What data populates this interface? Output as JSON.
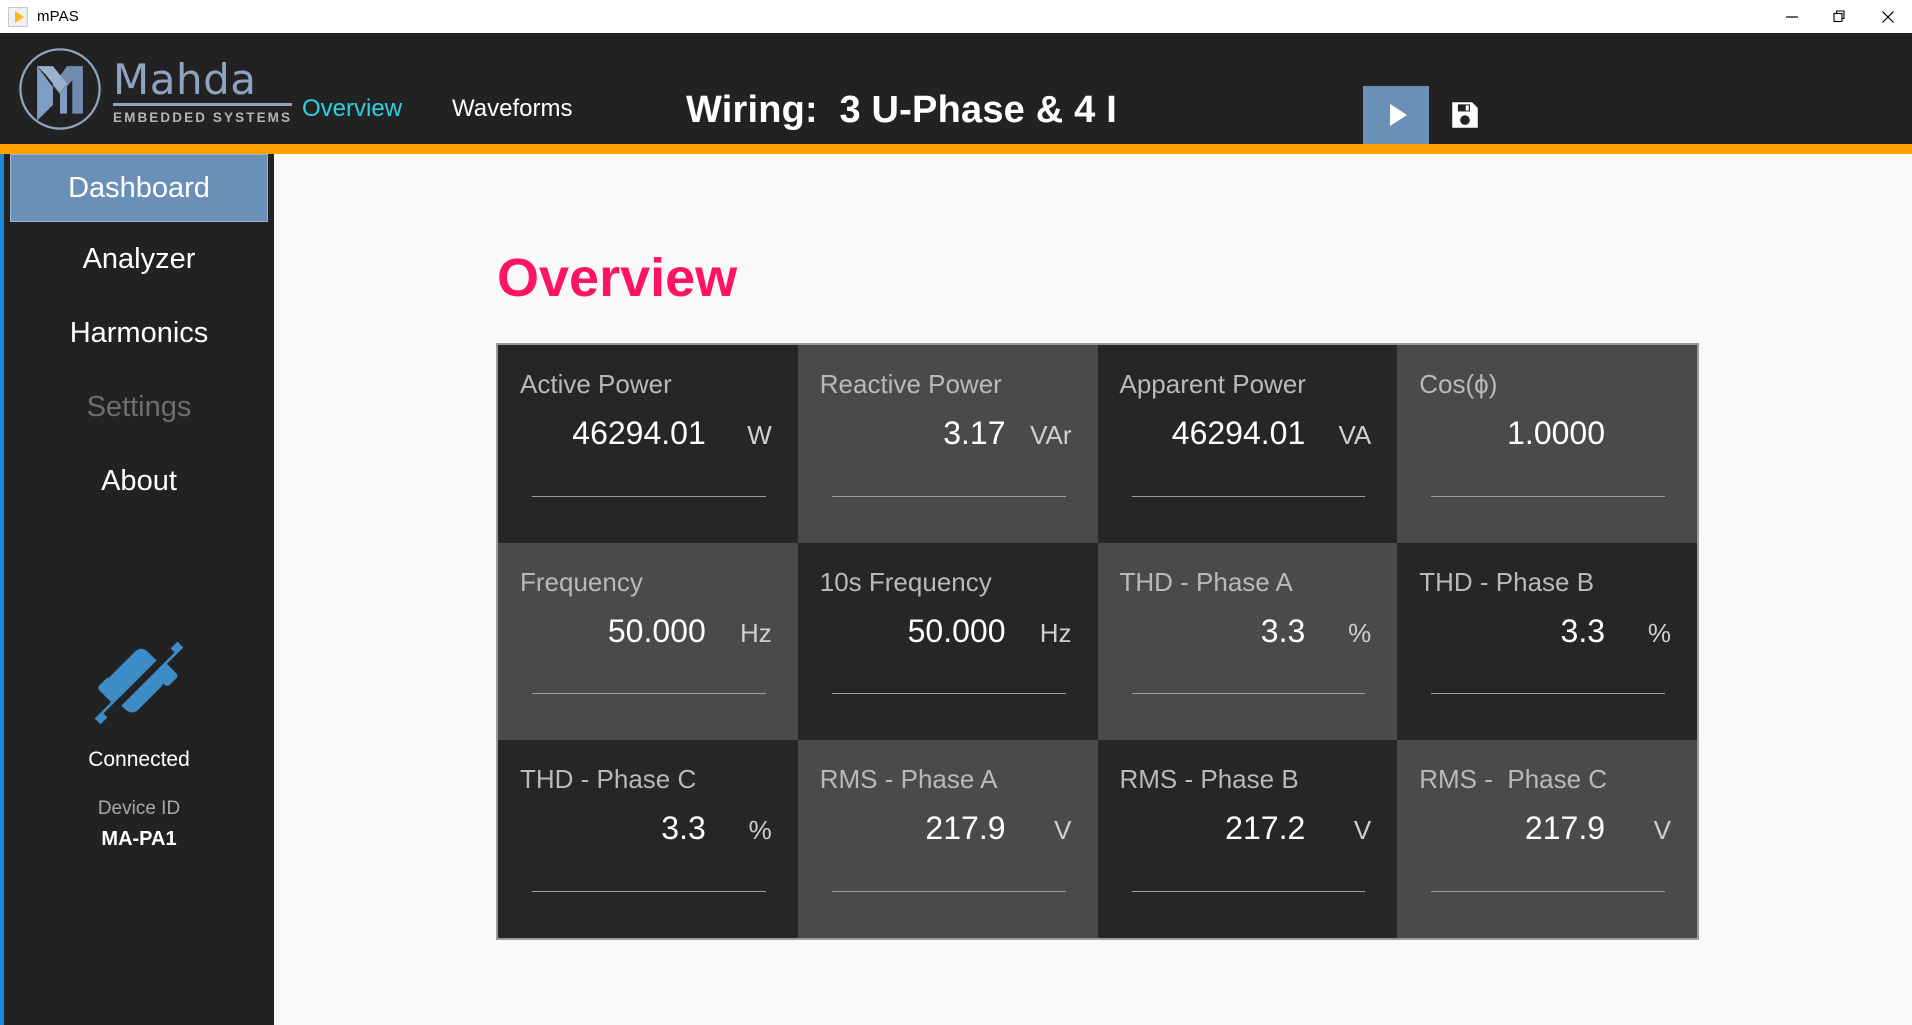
{
  "window": {
    "title": "mPAS",
    "app_icon": "play-app-icon",
    "controls": [
      {
        "name": "minimize",
        "glyph": "minimize-icon"
      },
      {
        "name": "restore",
        "glyph": "restore-icon"
      },
      {
        "name": "close",
        "glyph": "close-icon"
      }
    ]
  },
  "header": {
    "logo": {
      "word": "Mahda",
      "subtitle": "EMBEDDED SYSTEMS",
      "mark": "m-monogram-logo"
    },
    "nav": [
      {
        "label": "Overview",
        "active": true
      },
      {
        "label": "Waveforms",
        "active": false
      }
    ],
    "wiring_label": "Wiring:",
    "wiring_value": "3 U-Phase & 4 I",
    "play_button": "play-icon",
    "save_button": "floppy-save-icon",
    "accent_orange": "#FFA000",
    "nav_active_color": "#2AD2E6"
  },
  "sidebar": {
    "items": [
      {
        "label": "Dashboard",
        "state": "active"
      },
      {
        "label": "Analyzer",
        "state": "normal"
      },
      {
        "label": "Harmonics",
        "state": "normal"
      },
      {
        "label": "Settings",
        "state": "disabled"
      },
      {
        "label": "About",
        "state": "normal"
      }
    ],
    "connection": {
      "icon": "plug-connected-icon",
      "status": "Connected",
      "device_id_label": "Device ID",
      "device_id_value": "MA-PA1",
      "icon_color": "#3E8CC7"
    }
  },
  "main": {
    "title": "Overview",
    "title_color": "#FF1464",
    "cards": [
      {
        "label": "Active Power",
        "value": "46294.01",
        "unit": "W",
        "tone": "dark"
      },
      {
        "label": "Reactive Power",
        "value": "3.17",
        "unit": "VAr",
        "tone": "light"
      },
      {
        "label": "Apparent Power",
        "value": "46294.01",
        "unit": "VA",
        "tone": "dark"
      },
      {
        "label": "Cos(ϕ)",
        "value": "1.0000",
        "unit": "",
        "tone": "light"
      },
      {
        "label": "Frequency",
        "value": "50.000",
        "unit": "Hz",
        "tone": "light"
      },
      {
        "label": "10s Frequency",
        "value": "50.000",
        "unit": "Hz",
        "tone": "dark"
      },
      {
        "label": "THD - Phase A",
        "value": "3.3",
        "unit": "%",
        "tone": "light"
      },
      {
        "label": "THD - Phase B",
        "value": "3.3",
        "unit": "%",
        "tone": "dark"
      },
      {
        "label": "THD - Phase C",
        "value": "3.3",
        "unit": "%",
        "tone": "dark"
      },
      {
        "label": "RMS - Phase A",
        "value": "217.9",
        "unit": "V",
        "tone": "light"
      },
      {
        "label": "RMS - Phase B",
        "value": "217.2",
        "unit": "V",
        "tone": "dark"
      },
      {
        "label": "RMS -  Phase C",
        "value": "217.9",
        "unit": "V",
        "tone": "light"
      }
    ]
  }
}
